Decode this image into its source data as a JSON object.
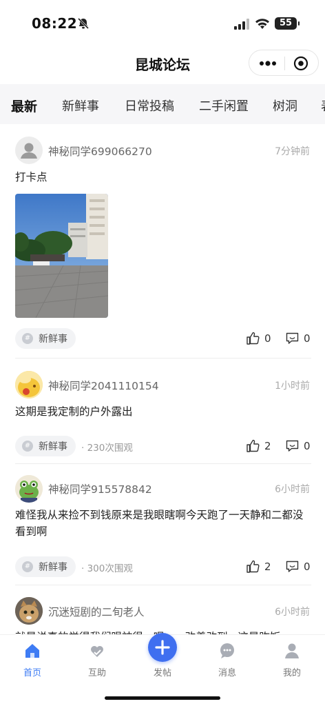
{
  "status_bar": {
    "time": "08:22",
    "battery": "55"
  },
  "nav": {
    "title": "昆城论坛"
  },
  "tabs": [
    "最新",
    "新鲜事",
    "日常投稿",
    "二手闲置",
    "树洞",
    "表"
  ],
  "posts": [
    {
      "username": "神秘同学699066270",
      "time": "7分钟前",
      "content": "打卡点",
      "has_image": true,
      "tag": "新鲜事",
      "views": "",
      "likes": "0",
      "comments": "0"
    },
    {
      "username": "神秘同学2041110154",
      "time": "1小时前",
      "content": "这期是我定制的户外露出",
      "tag": "新鲜事",
      "views": "· 230次围观",
      "likes": "2",
      "comments": "0"
    },
    {
      "username": "神秘同学915578842",
      "time": "6小时前",
      "content": "难怪我从来捡不到钱原来是我眼瞎啊今天跑了一天静和二都没看到啊",
      "tag": "新鲜事",
      "views": "· 300次围观",
      "likes": "2",
      "comments": "0"
    },
    {
      "username": "沉迷短剧的二旬老人",
      "time": "6小时前",
      "content": "就是说真的觉得我们眼神很...呢，...改善改到...这是昨饭"
    }
  ],
  "tabbar": {
    "home": "首页",
    "help": "互助",
    "post": "发帖",
    "messages": "消息",
    "mine": "我的"
  },
  "colors": {
    "accent": "#3e7cf4",
    "post_button": "#3f6ff0"
  }
}
